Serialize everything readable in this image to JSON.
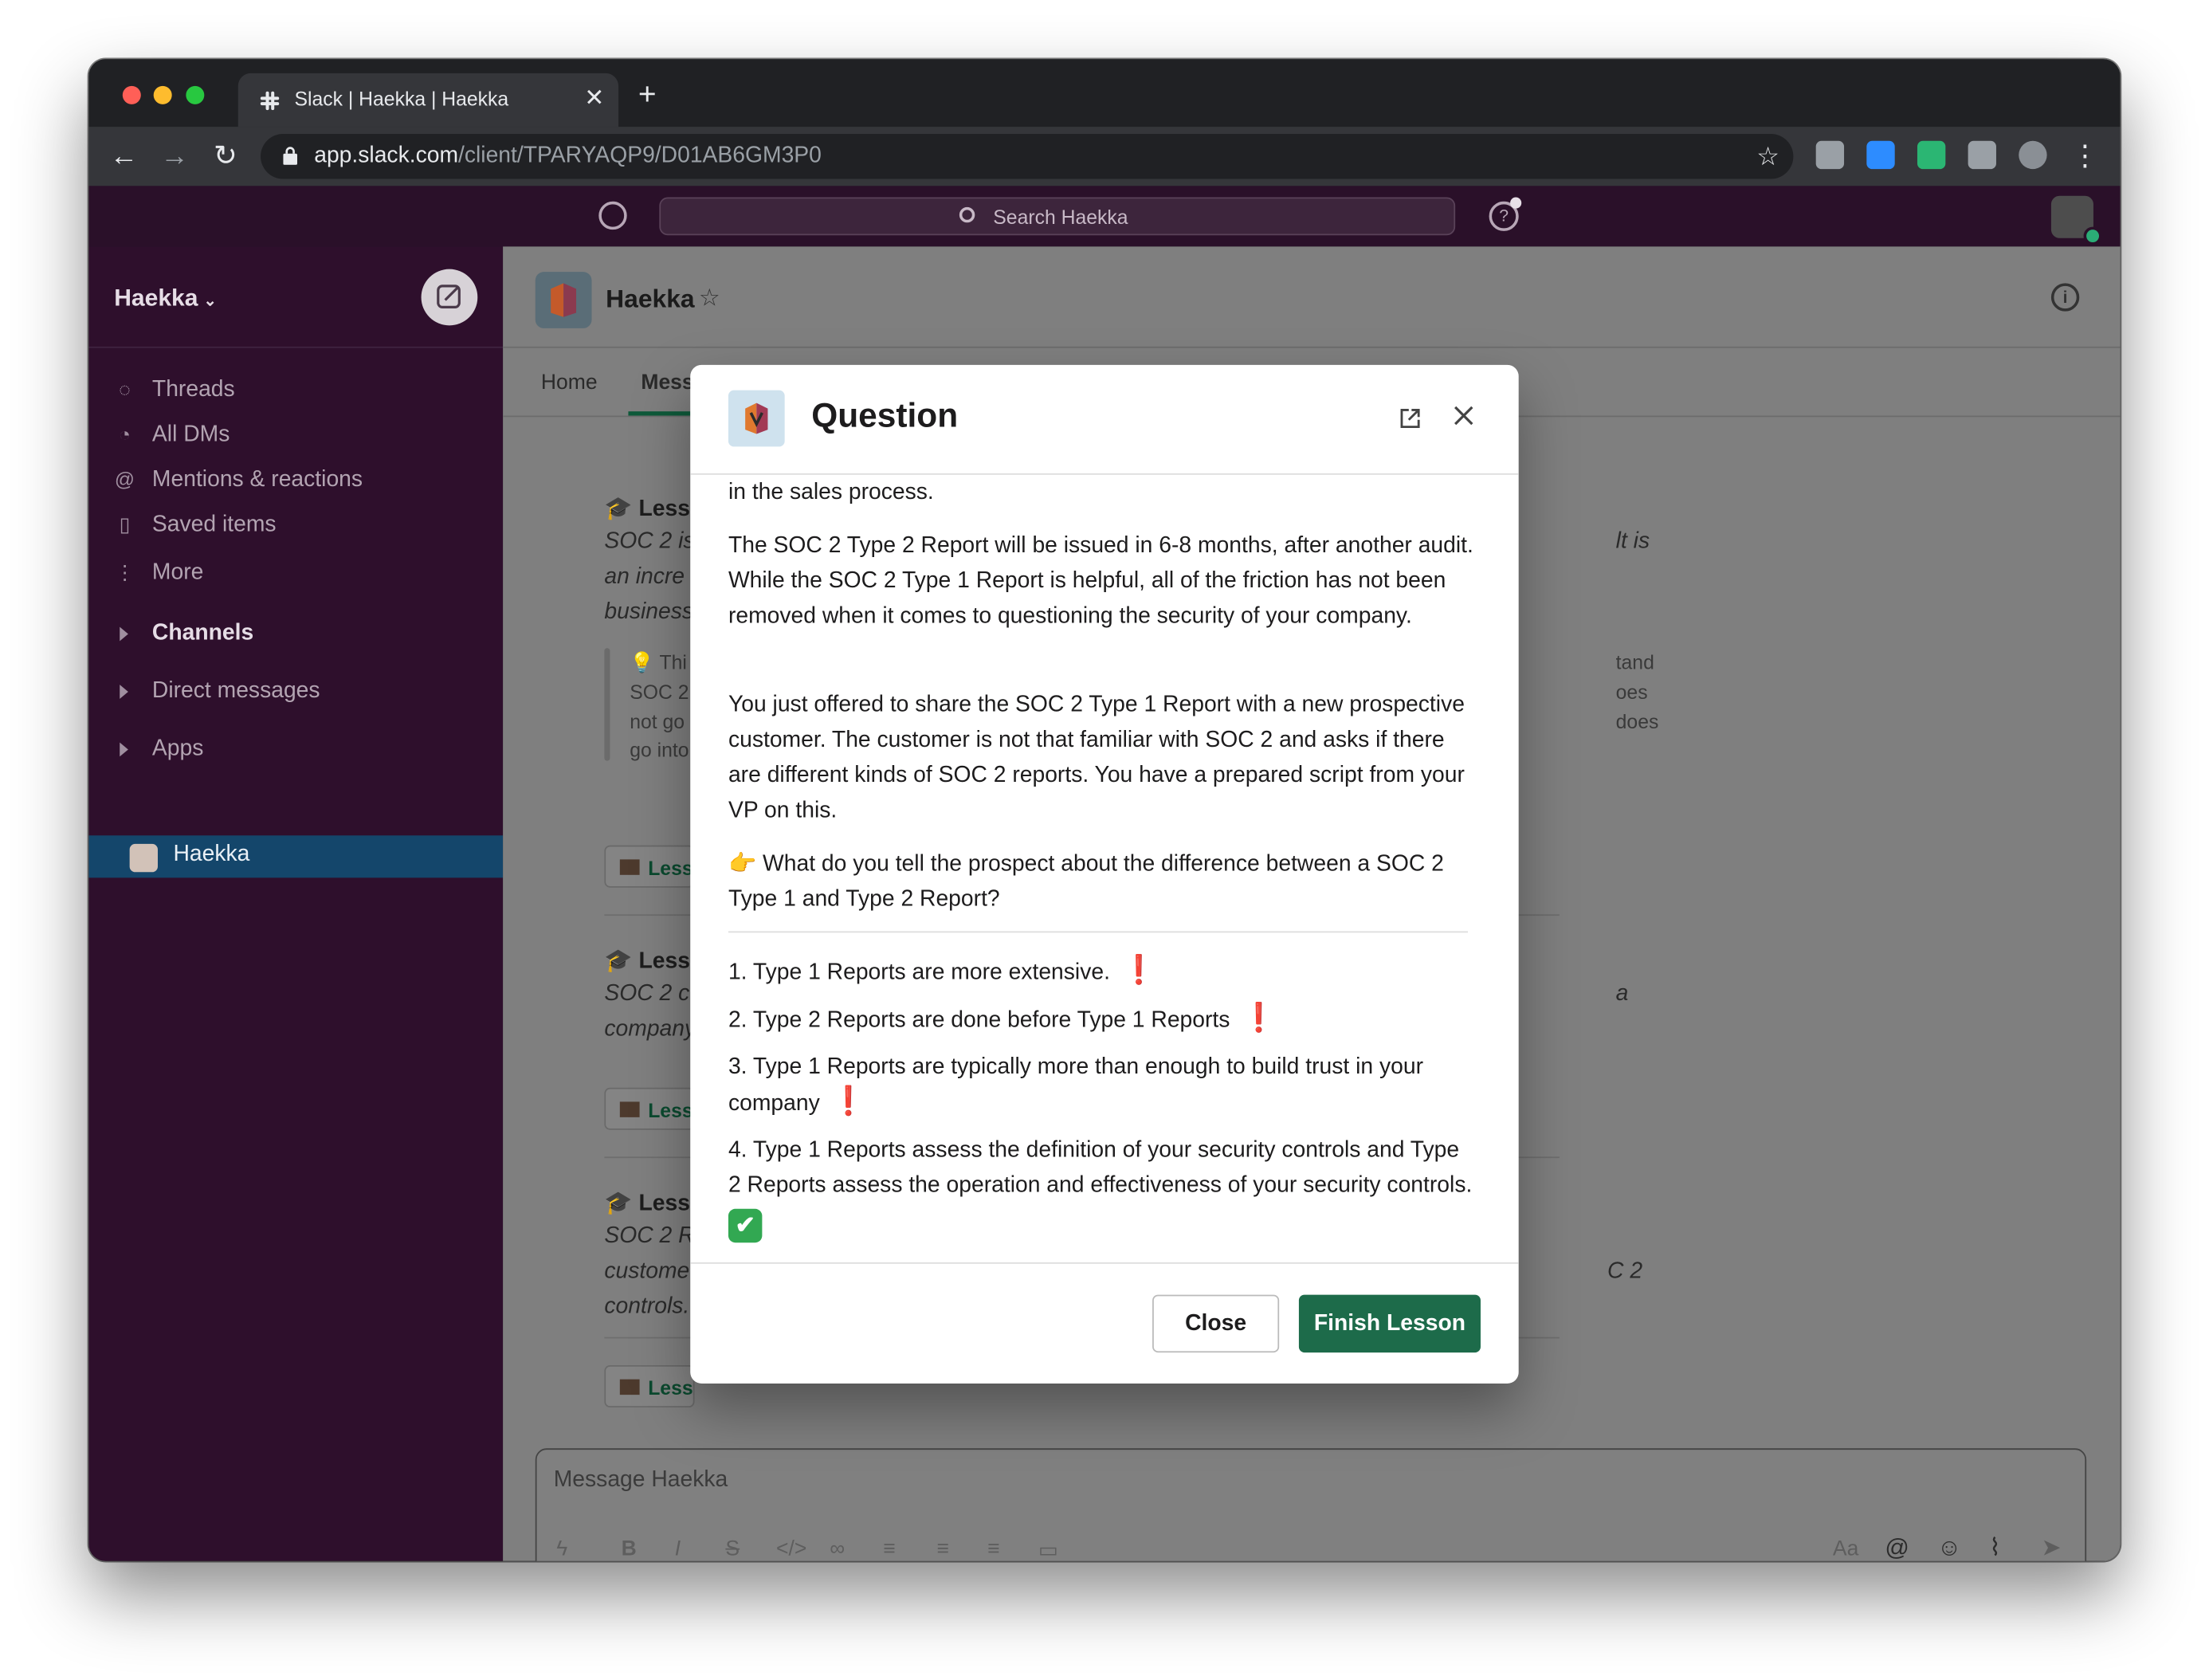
{
  "browser": {
    "tab_title": "Slack | Haekka | Haekka",
    "url_host": "app.slack.com",
    "url_path": "/client/TPARYAQP9/D01AB6GM3P0"
  },
  "slack_top": {
    "search_placeholder": "Search Haekka"
  },
  "sidebar": {
    "workspace": "Haekka",
    "items": [
      {
        "label": "Threads",
        "icon": "threads-icon"
      },
      {
        "label": "All DMs",
        "icon": "dms-icon"
      },
      {
        "label": "Mentions & reactions",
        "icon": "at-icon"
      },
      {
        "label": "Saved items",
        "icon": "bookmark-icon"
      },
      {
        "label": "More",
        "icon": "more-icon"
      }
    ],
    "sections": [
      "Channels",
      "Direct messages",
      "Apps"
    ],
    "active_app": "Haekka"
  },
  "channel": {
    "name": "Haekka",
    "tabs": [
      "Home",
      "Mess"
    ]
  },
  "messages": {
    "head_fragment": "Less",
    "button_fragment": "Less",
    "m1": {
      "l1": "SOC 2 is",
      "l2": "an incre",
      "l3": "business",
      "right": "lt is"
    },
    "q1": {
      "l1": "Thi",
      "l2": "SOC 2",
      "l3": "not go",
      "l4": "go into",
      "r1": "tand",
      "r2": "oes",
      "r3": "does"
    },
    "m2": {
      "l1": "SOC 2 c",
      "l2": "company",
      "right": "a"
    },
    "m3": {
      "l1": "SOC 2 R",
      "l2": "custome",
      "l3": "controls.",
      "right": "C 2"
    }
  },
  "composer": {
    "placeholder": "Message Haekka",
    "text_style": "Aa"
  },
  "modal": {
    "title": "Question",
    "p0": "in the sales process.",
    "p1": "The SOC 2 Type 2 Report will be issued in 6-8 months, after another audit. While the SOC 2 Type 1 Report is helpful, all of the friction has not been removed when it comes to questioning the security of your company.",
    "p2": "You just offered to share the SOC 2 Type 1 Report with a new prospective customer. The customer is not that familiar with SOC 2 and asks if there are different kinds of SOC 2 reports. You have a prepared script from your VP on this.",
    "p3_emoji": "👉",
    "p3": "What do you tell the prospect about the difference between a SOC 2 Type 1 and Type 2 Report?",
    "options": [
      {
        "text": "1. Type 1 Reports are more extensive.",
        "mark": "❗"
      },
      {
        "text": "2. Type 2 Reports are done before Type 1 Reports",
        "mark": "❗"
      },
      {
        "text": "3. Type 1 Reports are typically more than enough to build trust in your company",
        "mark": "❗"
      },
      {
        "text": "4. Type 1 Reports assess the definition of your security controls and Type 2 Reports assess the operation and effectiveness of your security controls.",
        "mark": "✔"
      }
    ],
    "close_label": "Close",
    "finish_label": "Finish Lesson"
  },
  "colors": {
    "sidebar": "#2e0f2c",
    "active_item": "#14466b",
    "primary_button": "#1d6b4a",
    "wrong_mark": "#d42b2b",
    "correct_mark": "#32a852"
  }
}
